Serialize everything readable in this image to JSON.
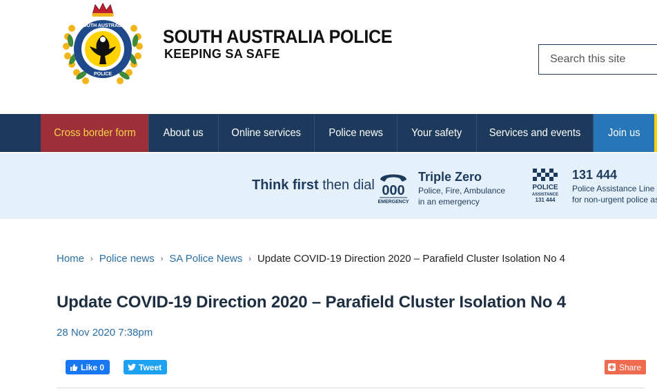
{
  "header": {
    "brand_title": "SOUTH AUSTRALIA POLICE",
    "brand_tagline": "KEEPING SA SAFE",
    "search_placeholder": "Search this site",
    "logo_icon": "sa-police-crest-icon"
  },
  "nav": {
    "items": [
      {
        "label": "Cross border form"
      },
      {
        "label": "About us"
      },
      {
        "label": "Online services"
      },
      {
        "label": "Police news"
      },
      {
        "label": "Your safety"
      },
      {
        "label": "Services and events"
      },
      {
        "label": "Join us"
      }
    ],
    "colors": {
      "bar": "#1d3a5c",
      "cross_border": "#9c2f37",
      "cross_border_text": "#ffd64d",
      "join": "#2676b8"
    }
  },
  "emergency": {
    "think_first": "Think first",
    "then_dial": "then dial",
    "triple_zero": {
      "icon": "emergency-000-phone-icon",
      "icon_digits": "000",
      "icon_label": "EMERGENCY",
      "title": "Triple Zero",
      "line1": "Police, Fire, Ambulance",
      "line2": "in an emergency"
    },
    "assistance": {
      "icon": "police-assistance-131444-icon",
      "icon_word": "POLICE",
      "icon_word2": "ASSISTANCE",
      "icon_number": "131 444",
      "title": "131 444",
      "line1": "Police Assistance Line",
      "line2": "for non-urgent police assistance"
    }
  },
  "breadcrumb": {
    "items": [
      "Home",
      "Police news",
      "SA Police News"
    ],
    "current": "Update COVID-19 Direction 2020 – Parafield Cluster Isolation No 4"
  },
  "article": {
    "title": "Update COVID-19 Direction 2020 – Parafield Cluster Isolation No 4",
    "date": "28 Nov 2020 7:38pm"
  },
  "social": {
    "like_label": "Like 0",
    "tweet_label": "Tweet",
    "share_label": "Share",
    "colors": {
      "facebook": "#1877f2",
      "twitter": "#1da1f2",
      "share": "#ef6b4f"
    }
  }
}
